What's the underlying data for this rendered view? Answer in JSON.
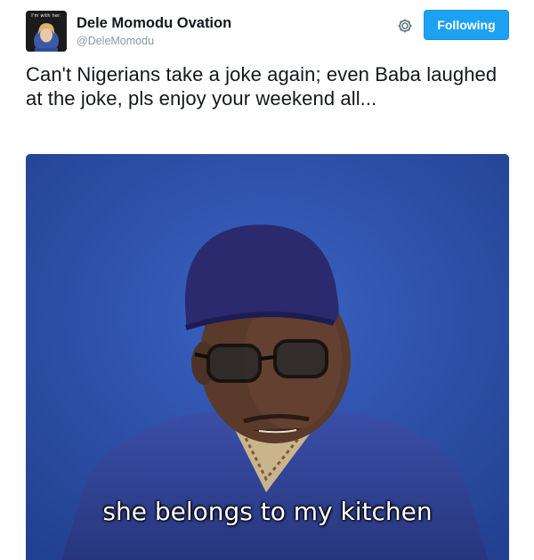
{
  "tweet": {
    "author": {
      "display_name": "Dele Momodu Ovation",
      "handle": "@DeleMomodu",
      "avatar_caption": "I'm with her."
    },
    "follow_button_label": "Following",
    "text": "Can't Nigerians take a joke again; even Baba laughed at the joke, pls enjoy your weekend all...",
    "media": {
      "type": "gif-still",
      "caption": "she belongs to my kitchen"
    }
  },
  "icons": {
    "settings": "gear-icon"
  },
  "colors": {
    "accent": "#1da1f2",
    "handle": "#8899a6",
    "text": "#14171a",
    "media_background": "#2a4a9e"
  }
}
